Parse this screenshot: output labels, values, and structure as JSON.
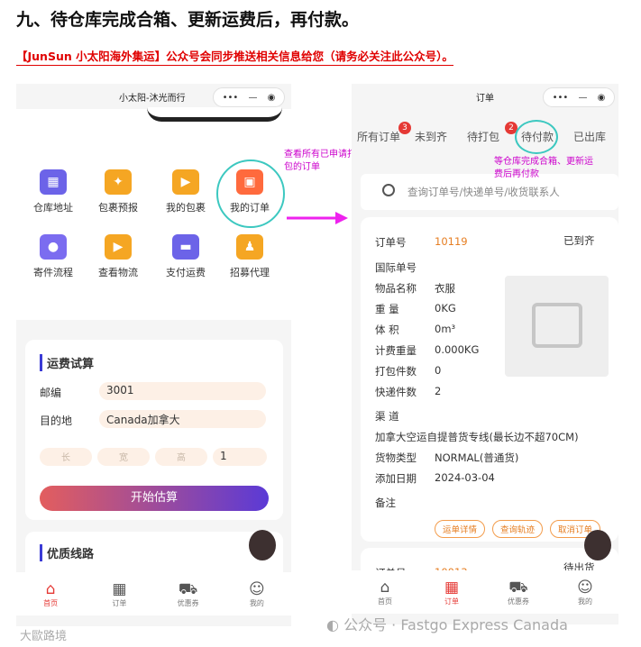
{
  "heading": "九、待仓库完成合箱、更新运费后，再付款。",
  "subheading": "【JunSun 小太阳海外集运】公众号会同步推送相关信息给您（请务必关注此公众号）。",
  "left_phone": {
    "title": "小太阳-沐光而行",
    "capsule": {
      "more": "•••",
      "minimize": "—",
      "close": "◉"
    },
    "menu": [
      {
        "label": "仓库地址",
        "icon": "map-icon",
        "color": "#6c63e8"
      },
      {
        "label": "包裹预报",
        "icon": "box-icon",
        "color": "#f5a623"
      },
      {
        "label": "我的包裹",
        "icon": "truck-icon",
        "color": "#f5a623"
      },
      {
        "label": "我的订单",
        "icon": "package-icon",
        "color": "#ff6a3d"
      },
      {
        "label": "寄件流程",
        "icon": "astronaut-icon",
        "color": "#7b6cf0"
      },
      {
        "label": "查看物流",
        "icon": "delivery-truck-icon",
        "color": "#f5a623"
      },
      {
        "label": "支付运费",
        "icon": "wallet-icon",
        "color": "#6c63e8"
      },
      {
        "label": "招募代理",
        "icon": "people-icon",
        "color": "#f5a623"
      }
    ],
    "estimate": {
      "title": "运费试算",
      "zip_label": "邮编",
      "zip_value": "3001",
      "dest_label": "目的地",
      "dest_value": "Canada加拿大",
      "length_ph": "长",
      "width_ph": "宽",
      "height_ph": "高",
      "weight_value": "1",
      "button": "开始估算"
    },
    "route_title": "优质线路",
    "nav": [
      {
        "label": "首页",
        "icon": "home-icon"
      },
      {
        "label": "订单",
        "icon": "grid-icon"
      },
      {
        "label": "优惠券",
        "icon": "cart-icon"
      },
      {
        "label": "我的",
        "icon": "user-icon"
      }
    ]
  },
  "annotation_left": "查看所有已申请打包的订单",
  "annotation_right": "等仓库完成合箱、更新运费后再付款",
  "right_phone": {
    "title": "订单",
    "capsule": {
      "more": "•••",
      "minimize": "—",
      "close": "◉"
    },
    "tabs": [
      {
        "label": "所有订单",
        "badge": "3"
      },
      {
        "label": "未到齐",
        "badge": ""
      },
      {
        "label": "待打包",
        "badge": "2"
      },
      {
        "label": "待付款",
        "badge": ""
      },
      {
        "label": "已出库",
        "badge": ""
      }
    ],
    "search_placeholder": "查询订单号/快递单号/收货联系人",
    "order": {
      "number_label": "订单号",
      "number_value": "10119",
      "status": "已到齐",
      "intl_label": "国际单号",
      "name_label": "物品名称",
      "name_value": "衣服",
      "weight_label": "重 量",
      "weight_value": "0KG",
      "volume_label": "体 积",
      "volume_value": "0m³",
      "billing_label": "计费重量",
      "billing_value": "0.000KG",
      "packs_label": "打包件数",
      "packs_value": "0",
      "express_label": "快递件数",
      "express_value": "2",
      "channel_label": "渠 道",
      "channel_value": "加拿大空运自提普货专线(最长边不超70CM)",
      "type_label": "货物类型",
      "type_value": "NORMAL(普通货)",
      "date_label": "添加日期",
      "date_value": "2024-03-04",
      "note_label": "备注",
      "btn_detail": "运单详情",
      "btn_track": "查询轨迹",
      "btn_cancel": "取消订单"
    },
    "order2": {
      "number_label": "订单号",
      "number_value": "10013",
      "status": "待出货"
    },
    "nav": [
      {
        "label": "首页",
        "icon": "home-icon"
      },
      {
        "label": "订单",
        "icon": "grid-icon"
      },
      {
        "label": "优惠券",
        "icon": "cart-icon"
      },
      {
        "label": "我的",
        "icon": "user-icon"
      }
    ]
  },
  "watermark_left": "大歐路境",
  "watermark_right": "公众号 · Fastgo Express Canada"
}
